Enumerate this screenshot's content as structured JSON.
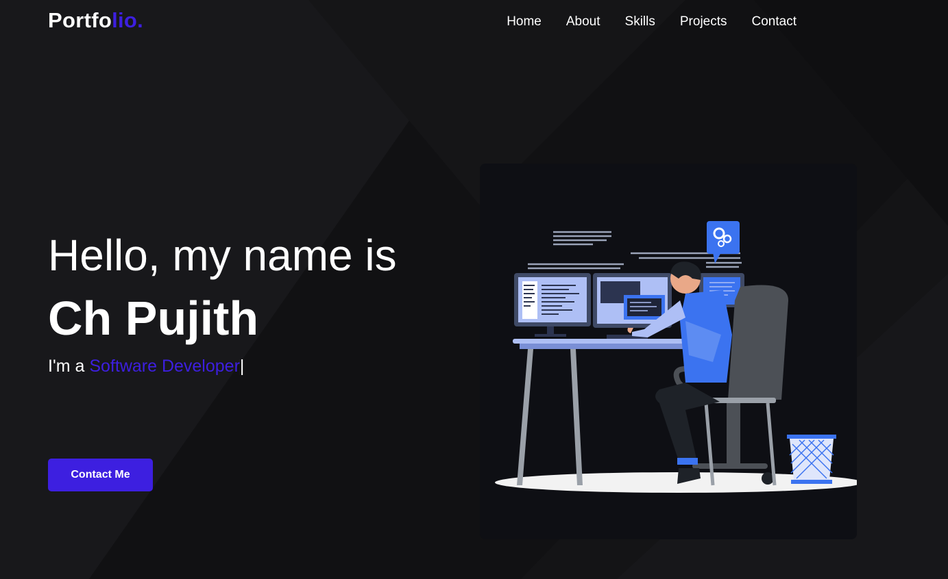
{
  "header": {
    "logo_main": "Portfo",
    "logo_accent": "lio."
  },
  "nav": {
    "items": [
      "Home",
      "About",
      "Skills",
      "Projects",
      "Contact"
    ]
  },
  "hero": {
    "greeting": "Hello, my name is",
    "name": "Ch Pujith",
    "role_prefix": "I'm a ",
    "role_typed": "Software Developer",
    "cursor": "|",
    "cta_label": "Contact Me"
  },
  "colors": {
    "background": "#141416",
    "accent": "#3d1fe0",
    "text": "#ffffff",
    "illustration_bg": "#0e0f14"
  }
}
